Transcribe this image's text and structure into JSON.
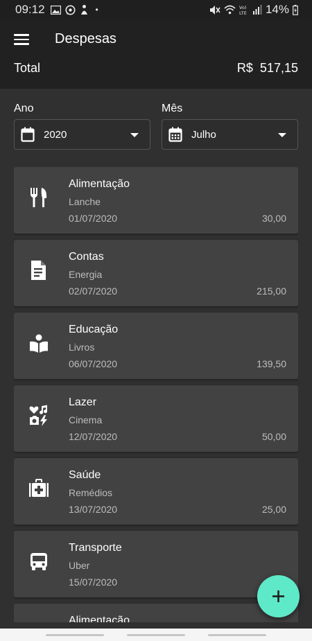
{
  "status": {
    "time": "09:12",
    "dot": "•",
    "battery": "14%"
  },
  "header": {
    "title": "Despesas",
    "total_label": "Total",
    "total_value": "R$  517,15"
  },
  "filters": {
    "year_label": "Ano",
    "year_value": "2020",
    "month_label": "Mês",
    "month_value": "Julho"
  },
  "expenses": [
    {
      "category": "Alimentação",
      "description": "Lanche",
      "date": "01/07/2020",
      "amount": "30,00",
      "icon": "restaurant-icon"
    },
    {
      "category": "Contas",
      "description": "Energia",
      "date": "02/07/2020",
      "amount": "215,00",
      "icon": "receipt-icon"
    },
    {
      "category": "Educação",
      "description": "Livros",
      "date": "06/07/2020",
      "amount": "139,50",
      "icon": "book-reader-icon"
    },
    {
      "category": "Lazer",
      "description": "Cinema",
      "date": "12/07/2020",
      "amount": "50,00",
      "icon": "leisure-icon"
    },
    {
      "category": "Saúde",
      "description": "Remédios",
      "date": "13/07/2020",
      "amount": "25,00",
      "icon": "medical-kit-icon"
    },
    {
      "category": "Transporte",
      "description": "Uber",
      "date": "15/07/2020",
      "amount": "",
      "icon": "bus-icon"
    },
    {
      "category": "Alimentação",
      "description": "",
      "date": "",
      "amount": "",
      "icon": "restaurant-icon"
    }
  ],
  "colors": {
    "accent": "#5ee9c9",
    "card": "#424242",
    "background": "#303030",
    "header": "#212121"
  }
}
